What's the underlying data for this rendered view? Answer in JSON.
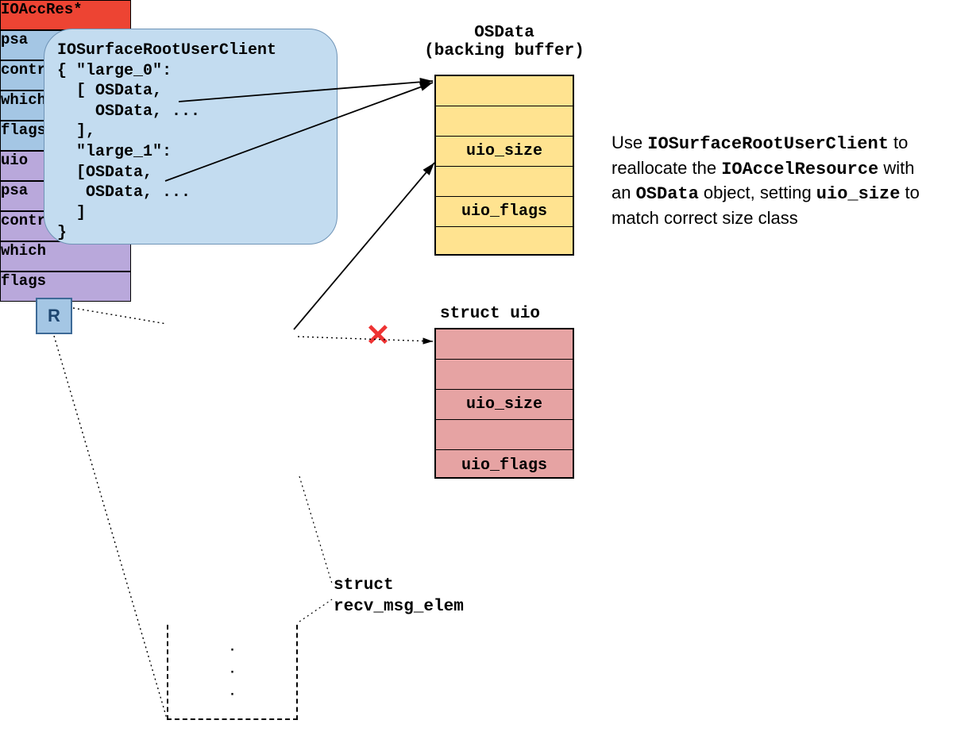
{
  "code_box": {
    "title": "IOSurfaceRootUserClient",
    "brace_open": "{",
    "key0": "\"large_0\"",
    "arr_open": "[",
    "item": "OSData",
    "ellipsis": "...",
    "arr_close": "]",
    "key1": "\"large_1\"",
    "brace_close": "}"
  },
  "r_label": "R",
  "osdata_header": [
    "OSData",
    "(backing buffer)"
  ],
  "osdata_rows": [
    "",
    "",
    "uio_size",
    "",
    "uio_flags",
    ""
  ],
  "uio_header": "struct uio",
  "uio_rows": [
    "",
    "",
    "uio_size",
    "",
    "uio_flags"
  ],
  "stack_rows": [
    {
      "text": "IOAccRes*",
      "cls": "stack-red"
    },
    {
      "text": "psa",
      "cls": "stack-blue"
    },
    {
      "text": "controlp",
      "cls": "stack-blue"
    },
    {
      "text": "which",
      "cls": "stack-blue"
    },
    {
      "text": "flags",
      "cls": "stack-blue"
    },
    {
      "text": "uio",
      "cls": "stack-purple"
    },
    {
      "text": "psa",
      "cls": "stack-purple"
    },
    {
      "text": "controlp",
      "cls": "stack-purple"
    },
    {
      "text": "which",
      "cls": "stack-purple"
    },
    {
      "text": "flags",
      "cls": "stack-purple"
    }
  ],
  "struct_label": [
    "struct",
    "recv_msg_elem"
  ],
  "description": {
    "p1a": "Use ",
    "p1b": "IOSurfaceRootUserClient",
    "p1c": " to reallocate the ",
    "p1d": "IOAccelResource",
    "p1e": " with an ",
    "p1f": "OSData",
    "p1g": " object, setting ",
    "p1h": "uio_size",
    "p1i": " to match correct size class"
  }
}
